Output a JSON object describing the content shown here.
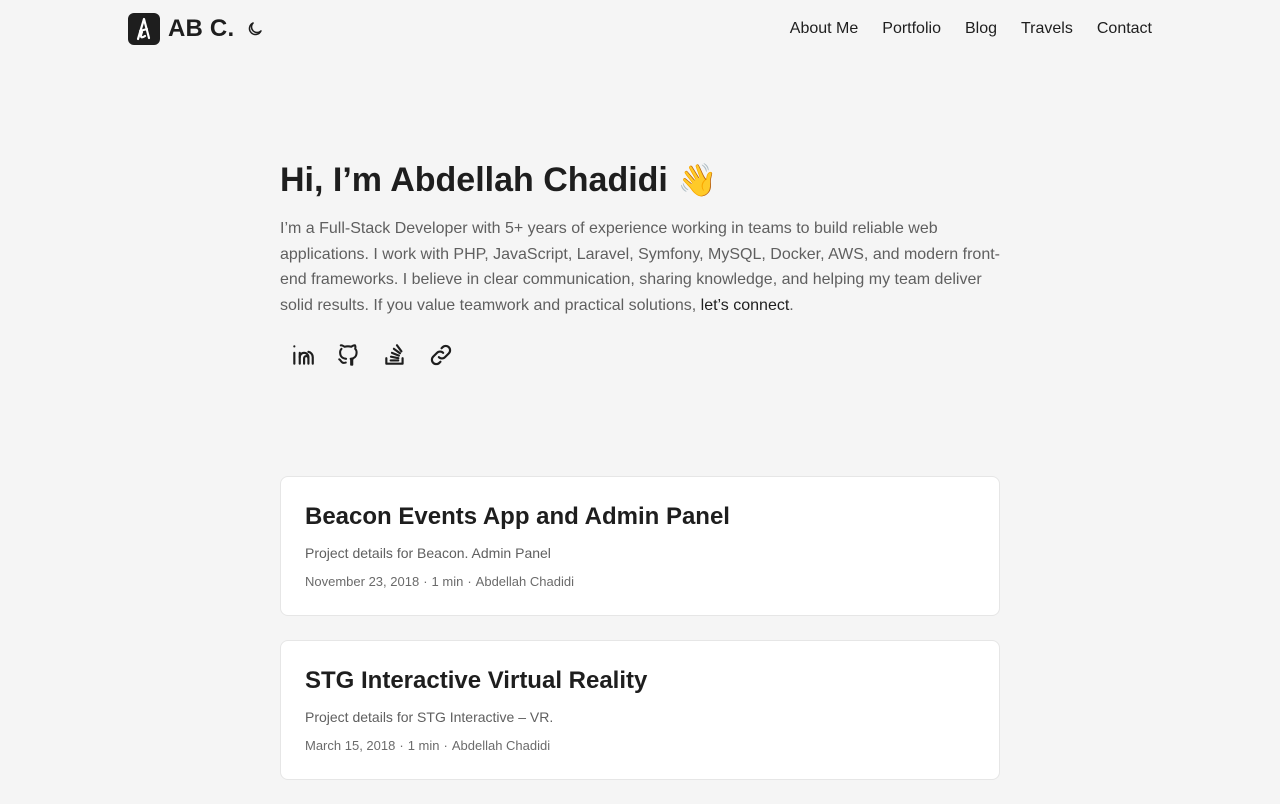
{
  "header": {
    "brand": "AB C.",
    "logo_icon": "signature-logo-icon",
    "theme_icon": "moon-icon",
    "nav": [
      {
        "label": "About Me"
      },
      {
        "label": "Portfolio"
      },
      {
        "label": "Blog"
      },
      {
        "label": "Travels"
      },
      {
        "label": "Contact"
      }
    ]
  },
  "hero": {
    "title": "Hi, I’m Abdellah Chadidi",
    "emoji": "👋",
    "description": "I’m a Full-Stack Developer with 5+ years of experience working in teams to build reliable web applications. I work with PHP, JavaScript, Laravel, Symfony, MySQL, Docker, AWS, and modern front-end frameworks. I believe in clear communication, sharing knowledge, and helping my team deliver solid results. If you value teamwork and practical solutions, ",
    "connect_link": "let’s connect",
    "description_end": ".",
    "social_icons": [
      "linkedin-icon",
      "github-icon",
      "stackoverflow-icon",
      "link-icon"
    ]
  },
  "posts": [
    {
      "title": "Beacon Events App and Admin Panel",
      "summary": "Project details for Beacon. Admin Panel",
      "date": "November 23, 2018",
      "read_time": "1 min",
      "author": "Abdellah Chadidi"
    },
    {
      "title": "STG Interactive Virtual Reality",
      "summary": "Project details for STG Interactive – VR.",
      "date": "March 15, 2018",
      "read_time": "1 min",
      "author": "Abdellah Chadidi"
    }
  ],
  "meta_separator": "·",
  "colors": {
    "background": "#f5f5f5",
    "text": "#1e1e1e",
    "muted": "#5f5f5f",
    "card": "#ffffff"
  }
}
